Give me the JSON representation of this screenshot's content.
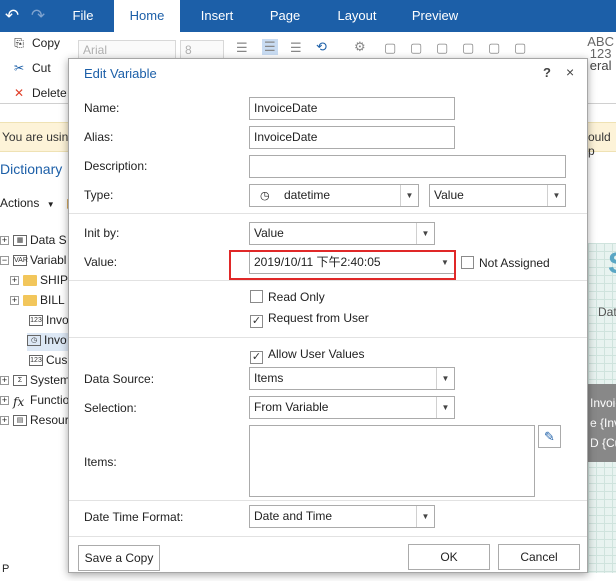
{
  "ribbon": {
    "tabs": [
      "File",
      "Home",
      "Insert",
      "Page",
      "Layout",
      "Preview"
    ],
    "active_tab": "Home",
    "clipboard": {
      "copy": "Copy",
      "cut": "Cut",
      "delete": "Delete"
    },
    "font_name": "Arial",
    "font_size": "8",
    "style_label": "ABC\n123",
    "style_suffix": "eral"
  },
  "notice": {
    "left_text": "You are using",
    "right_text": "ould p"
  },
  "dictionary": {
    "title": "Dictionary",
    "actions": "Actions",
    "tree": [
      {
        "label": "Data S",
        "icon": "data-source-icon"
      },
      {
        "label": "Variabl",
        "icon": "variable-icon"
      },
      {
        "label": "SHIP",
        "icon": "folder-icon"
      },
      {
        "label": "BILL",
        "icon": "folder-icon"
      },
      {
        "label": "Invo",
        "icon": "number-variable-icon"
      },
      {
        "label": "Invo",
        "icon": "datetime-variable-icon"
      },
      {
        "label": "Cus",
        "icon": "number-variable-icon"
      },
      {
        "label": "System",
        "icon": "system-variable-icon"
      },
      {
        "label": "Functio",
        "icon": "function-icon"
      },
      {
        "label": "Resour",
        "icon": "resource-icon"
      }
    ],
    "bottom_text": "P"
  },
  "canvas": {
    "big_letter": "S",
    "header_text": "Dat",
    "row1": "Invoice",
    "row2": "e {Inv",
    "row3": "D {Cu"
  },
  "dialog": {
    "title": "Edit Variable",
    "help": "?",
    "close": "×",
    "labels": {
      "name": "Name:",
      "alias": "Alias:",
      "description": "Description:",
      "type": "Type:",
      "init_by": "Init by:",
      "value": "Value:",
      "data_source": "Data Source:",
      "selection": "Selection:",
      "items": "Items:",
      "date_time_format": "Date Time Format:"
    },
    "name_value": "InvoiceDate",
    "alias_value": "InvoiceDate",
    "description_value": "",
    "type_value": "datetime",
    "type_kind": "Value",
    "init_by_value": "Value",
    "value_value": "2019/10/11 下午2:40:05",
    "not_assigned": "Not Assigned",
    "read_only": "Read Only",
    "request_from_user": "Request from User",
    "allow_user_values": "Allow User Values",
    "data_source_value": "Items",
    "selection_value": "From Variable",
    "date_time_format_value": "Date and Time",
    "checks": {
      "not_assigned": false,
      "read_only": false,
      "request_from_user": true,
      "allow_user_values": true
    },
    "buttons": {
      "save_copy": "Save a Copy",
      "ok": "OK",
      "cancel": "Cancel"
    }
  },
  "colors": {
    "ribbon": "#1c5fa8",
    "highlight": "#e02828",
    "title": "#1c5fa8"
  }
}
